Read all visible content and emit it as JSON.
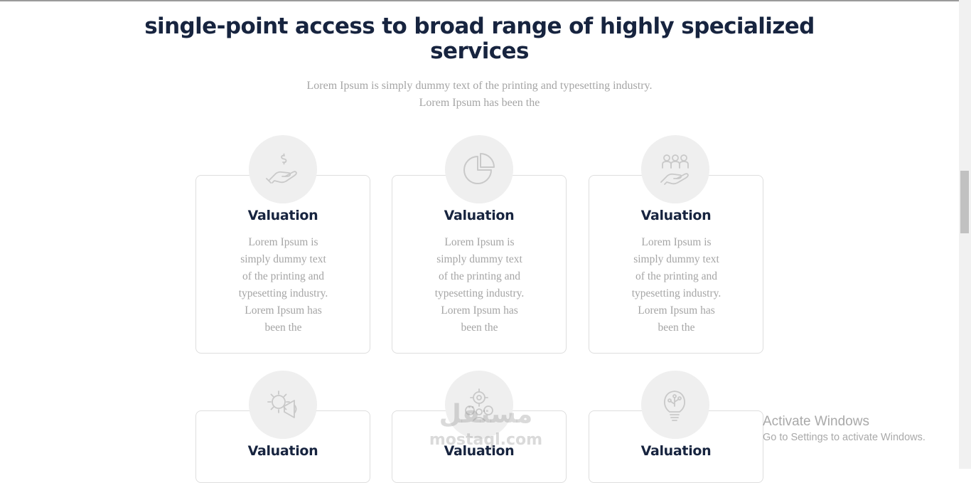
{
  "section": {
    "heading": "single-point access to broad range of highly specialized services",
    "intro": "Lorem Ipsum is simply dummy text of the printing and typesetting industry. Lorem Ipsum has been the"
  },
  "cards": [
    {
      "icon": "hand-dollar-icon",
      "title": "Valuation",
      "text": "Lorem Ipsum is simply dummy text of the printing and typesetting industry. Lorem Ipsum has been the"
    },
    {
      "icon": "pie-chart-icon",
      "title": "Valuation",
      "text": "Lorem Ipsum is simply dummy text of the printing and typesetting industry. Lorem Ipsum has been the"
    },
    {
      "icon": "hand-people-icon",
      "title": "Valuation",
      "text": "Lorem Ipsum is simply dummy text of the printing and typesetting industry. Lorem Ipsum has been the"
    },
    {
      "icon": "gear-megaphone-icon",
      "title": "Valuation",
      "text": ""
    },
    {
      "icon": "gears-person-icon",
      "title": "Valuation",
      "text": ""
    },
    {
      "icon": "bulb-circuit-icon",
      "title": "Valuation",
      "text": ""
    }
  ],
  "os_overlay": {
    "title": "Activate Windows",
    "subtitle": "Go to Settings to activate Windows."
  },
  "watermark": {
    "arabic": "مستقل",
    "latin": "mostaql.com"
  },
  "colors": {
    "heading": "#17243f",
    "body_text": "#a5a5a5",
    "icon_bg": "#efefef",
    "card_border": "#dedede"
  }
}
